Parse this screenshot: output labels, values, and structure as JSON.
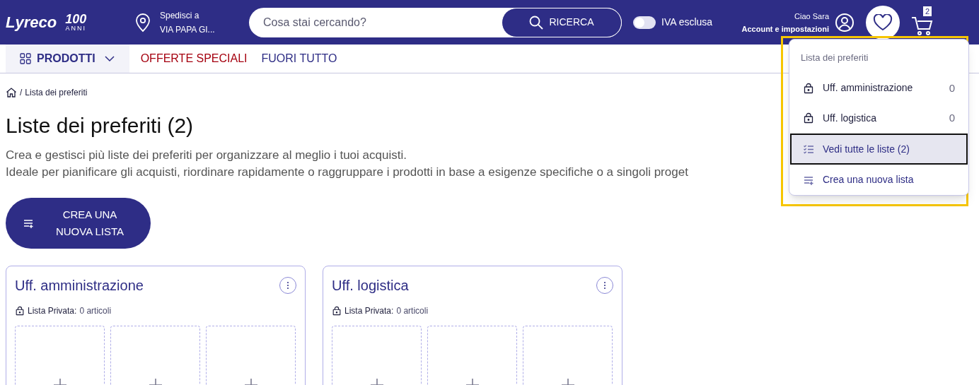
{
  "header": {
    "logo": "Lyreco",
    "anniversary": "100",
    "anniversary_caption": "ANNI",
    "shipping": {
      "label": "Spedisci a",
      "address": "VIA PAPA GI..."
    },
    "search": {
      "placeholder": "Cosa stai cercando?",
      "button": "RICERCA"
    },
    "vat_toggle": {
      "label": "IVA esclusa",
      "on": false
    },
    "account": {
      "greeting": "Ciao Sara",
      "link": "Account e impostazioni"
    },
    "favorites_button": {
      "active": true
    },
    "cart": {
      "count": "2"
    }
  },
  "nav": [
    {
      "label": "PRODOTTI",
      "kind": "menu"
    },
    {
      "label": "OFFERTE SPECIALI",
      "kind": "promo"
    },
    {
      "label": "FUORI TUTTO",
      "kind": "link"
    }
  ],
  "breadcrumb": {
    "separator": "/",
    "items": [
      "Lista dei preferiti"
    ]
  },
  "page": {
    "title": "Liste dei preferiti (2)",
    "description": [
      "Crea e gestisci più liste dei preferiti per organizzare al meglio i tuoi acquisti.",
      "Ideale per pianificare gli acquisti, riordinare rapidamente o raggruppare i prodotti in base a esigenze specifiche o a singoli proget"
    ],
    "create_button": "CREA UNA NUOVA LISTA"
  },
  "lists": [
    {
      "name": "Uff. amministrazione",
      "privacy": "Lista Privata:",
      "count": "0 articoli",
      "slots": [
        {
          "kind": "empty"
        },
        {
          "kind": "empty"
        },
        {
          "kind": "empty"
        }
      ]
    },
    {
      "name": "Uff. logistica",
      "privacy": "Lista Privata:",
      "count": "0 articoli",
      "slots": [
        {
          "kind": "empty"
        },
        {
          "kind": "empty"
        },
        {
          "kind": "empty"
        }
      ]
    }
  ],
  "dropdown": {
    "title": "Lista dei preferiti",
    "items": [
      {
        "kind": "list",
        "label": "Uff. amministrazione",
        "count": "0",
        "selected": false
      },
      {
        "kind": "list",
        "label": "Uff. logistica",
        "count": "0",
        "selected": false
      },
      {
        "kind": "view_all",
        "label": "Vedi tutte le liste (2)",
        "selected": true
      },
      {
        "kind": "create",
        "label": "Crea una nuova lista",
        "selected": false
      }
    ]
  }
}
